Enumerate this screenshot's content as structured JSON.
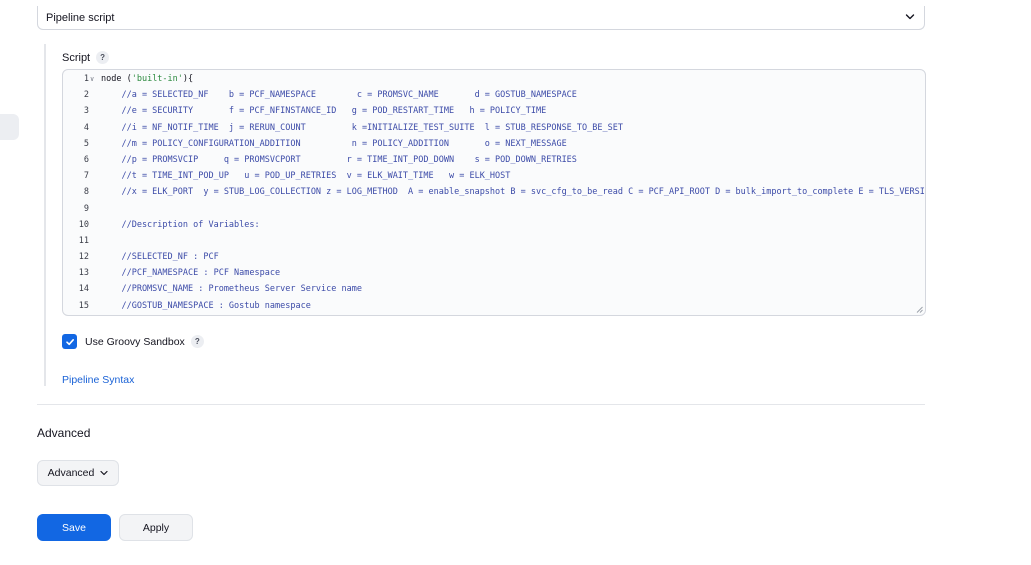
{
  "definition": {
    "selected": "Pipeline script"
  },
  "script": {
    "label": "Script",
    "help": "?",
    "lines": [
      {
        "n": "1",
        "fold": true,
        "tokens": [
          {
            "t": "node (",
            "c": "plain"
          },
          {
            "t": "'built-in'",
            "c": "str"
          },
          {
            "t": "){",
            "c": "plain"
          }
        ]
      },
      {
        "n": "2",
        "text": "    //a = SELECTED_NF    b = PCF_NAMESPACE        c = PROMSVC_NAME       d = GOSTUB_NAMESPACE"
      },
      {
        "n": "3",
        "text": "    //e = SECURITY       f = PCF_NFINSTANCE_ID   g = POD_RESTART_TIME   h = POLICY_TIME"
      },
      {
        "n": "4",
        "text": "    //i = NF_NOTIF_TIME  j = RERUN_COUNT         k =INITIALIZE_TEST_SUITE  l = STUB_RESPONSE_TO_BE_SET"
      },
      {
        "n": "5",
        "text": "    //m = POLICY_CONFIGURATION_ADDITION          n = POLICY_ADDITION       o = NEXT_MESSAGE"
      },
      {
        "n": "6",
        "text": "    //p = PROMSVCIP     q = PROMSVCPORT         r = TIME_INT_POD_DOWN    s = POD_DOWN_RETRIES"
      },
      {
        "n": "7",
        "text": "    //t = TIME_INT_POD_UP   u = POD_UP_RETRIES  v = ELK_WAIT_TIME   w = ELK_HOST"
      },
      {
        "n": "8",
        "text": "    //x = ELK_PORT  y = STUB_LOG_COLLECTION z = LOG_METHOD  A = enable_snapshot B = svc_cfg_to_be_read C = PCF_API_ROOT D = bulk_import_to_complete E = TLS_VERSION"
      },
      {
        "n": "9",
        "text": ""
      },
      {
        "n": "10",
        "text": "    //Description of Variables:"
      },
      {
        "n": "11",
        "text": ""
      },
      {
        "n": "12",
        "text": "    //SELECTED_NF : PCF"
      },
      {
        "n": "13",
        "text": "    //PCF_NAMESPACE : PCF Namespace"
      },
      {
        "n": "14",
        "text": "    //PROMSVC_NAME : Prometheus Server Service name"
      },
      {
        "n": "15",
        "text": "    //GOSTUB_NAMESPACE : Gostub namespace"
      }
    ]
  },
  "sandbox": {
    "label": "Use Groovy Sandbox",
    "checked": true,
    "help": "?"
  },
  "pipeline_syntax_link": "Pipeline Syntax",
  "advanced": {
    "heading": "Advanced",
    "button": "Advanced"
  },
  "actions": {
    "save": "Save",
    "apply": "Apply"
  },
  "colors": {
    "accent": "#1267e3",
    "link": "#1a62d6",
    "comment": "#3c4ba8",
    "string": "#2b8a3e"
  }
}
